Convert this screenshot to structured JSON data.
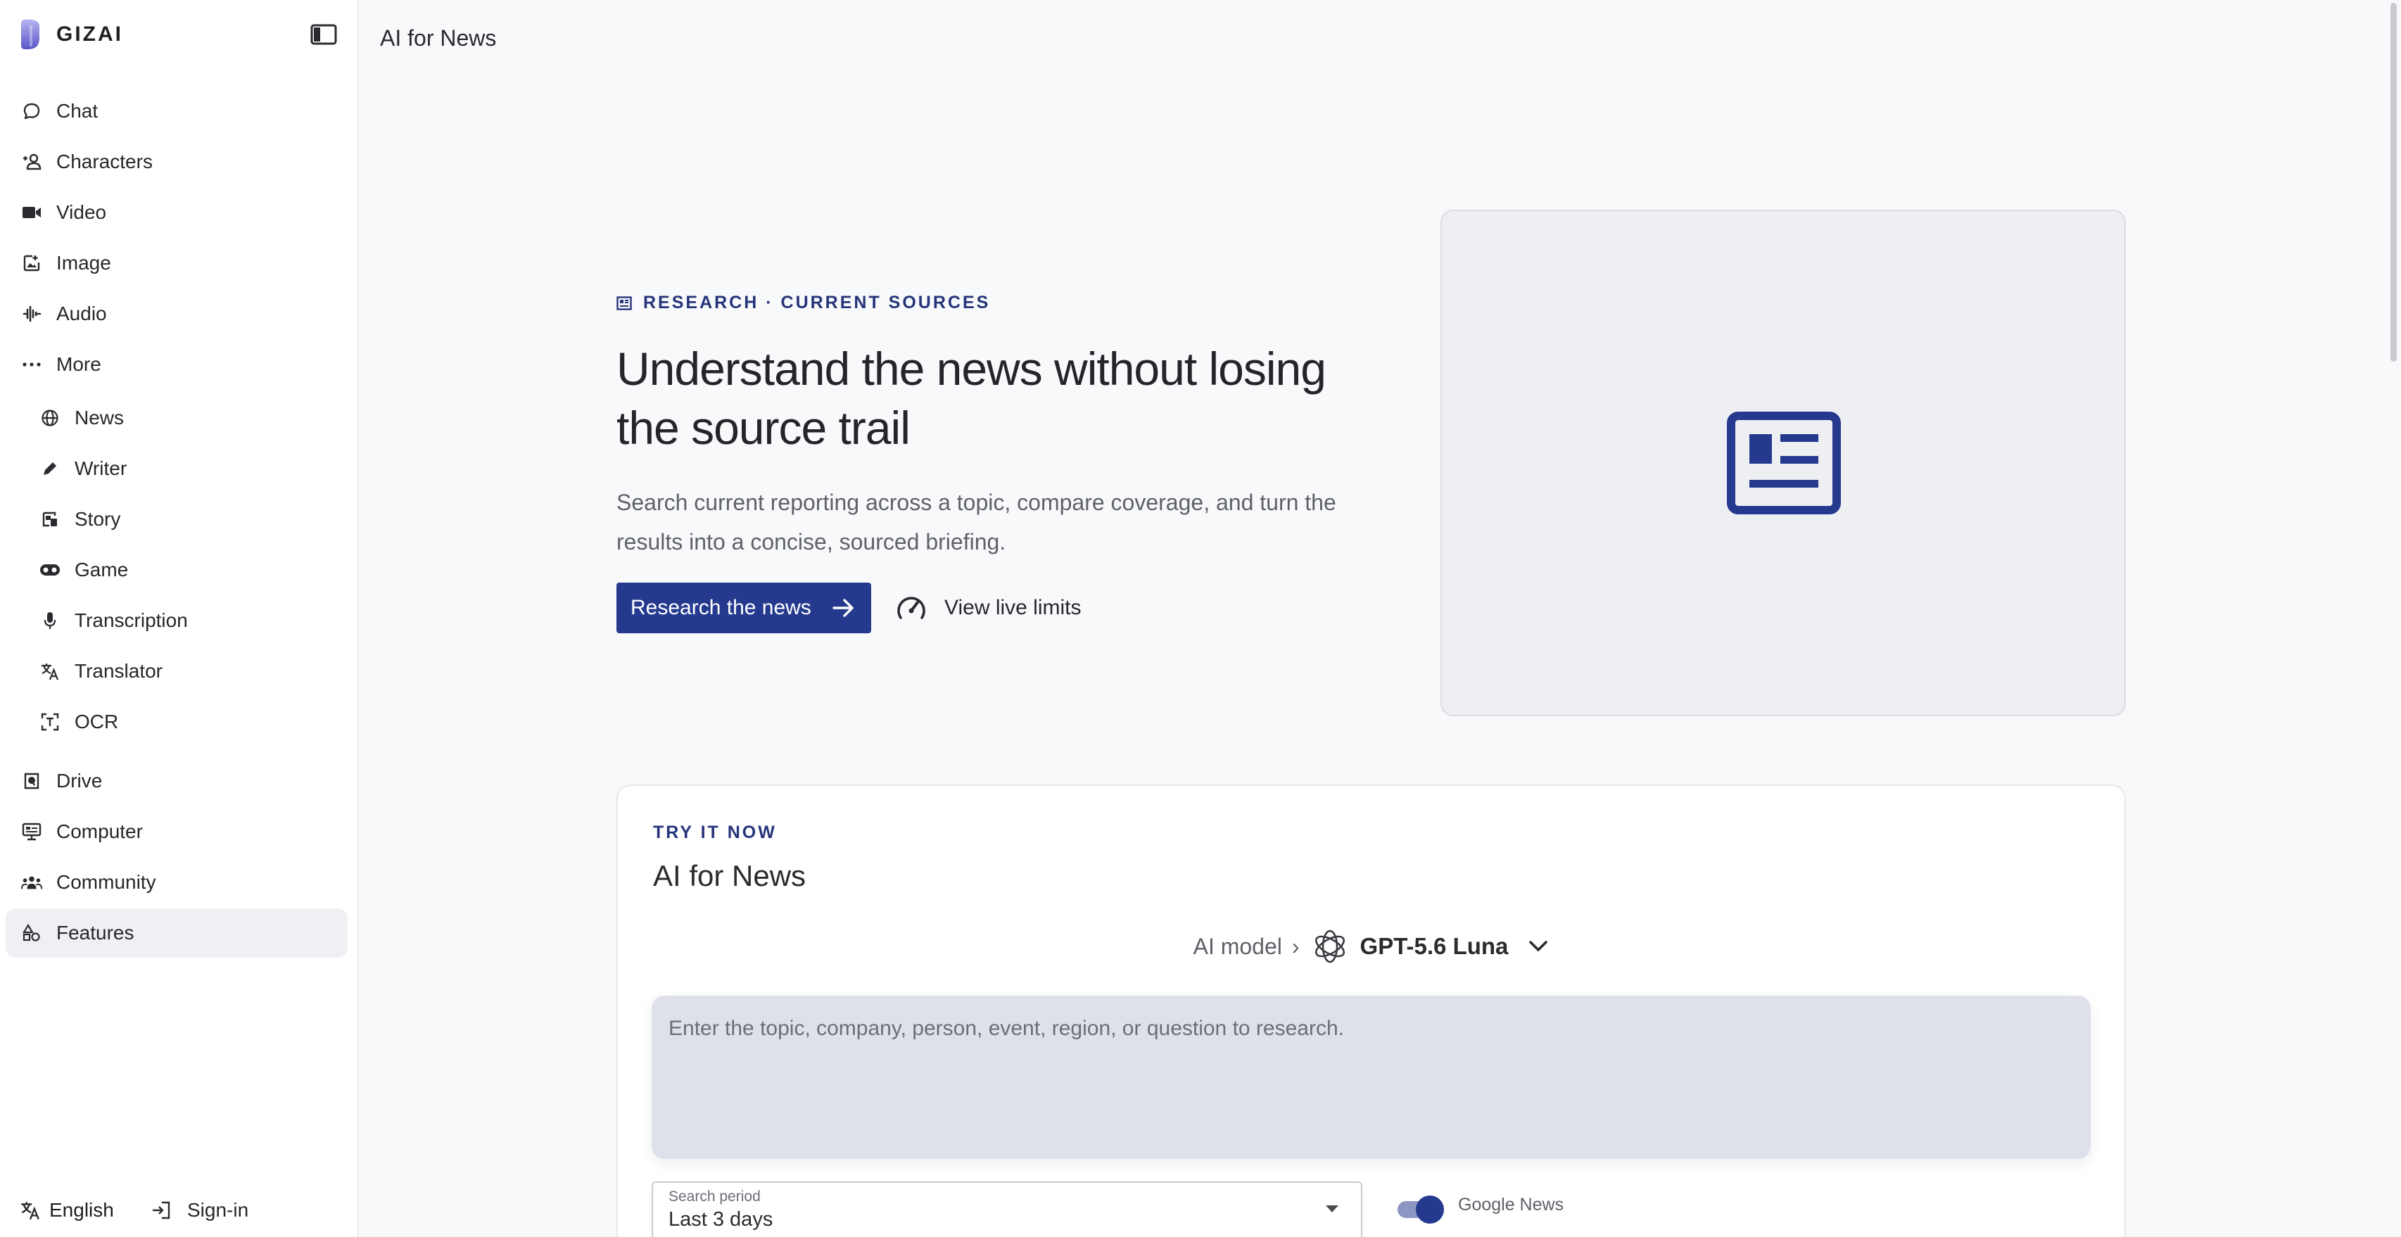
{
  "brand": {
    "name": "GIZAI"
  },
  "header": {
    "title": "AI for News"
  },
  "sidebar": {
    "items": [
      {
        "label": "Chat",
        "icon": "chat-bubble-icon"
      },
      {
        "label": "Characters",
        "icon": "person-add-icon"
      },
      {
        "label": "Video",
        "icon": "video-camera-icon"
      },
      {
        "label": "Image",
        "icon": "image-icon"
      },
      {
        "label": "Audio",
        "icon": "waveform-icon"
      },
      {
        "label": "More",
        "icon": "more-dots-icon"
      }
    ],
    "sub_items": [
      {
        "label": "News",
        "icon": "globe-icon"
      },
      {
        "label": "Writer",
        "icon": "pen-icon"
      },
      {
        "label": "Story",
        "icon": "story-book-icon"
      },
      {
        "label": "Game",
        "icon": "gamepad-icon"
      },
      {
        "label": "Transcription",
        "icon": "microphone-icon"
      },
      {
        "label": "Translator",
        "icon": "translate-icon"
      },
      {
        "label": "OCR",
        "icon": "text-scan-icon"
      }
    ],
    "bottom_items": [
      {
        "label": "Drive",
        "icon": "drive-icon"
      },
      {
        "label": "Computer",
        "icon": "monitor-icon"
      },
      {
        "label": "Community",
        "icon": "people-icon"
      },
      {
        "label": "Features",
        "icon": "shapes-icon",
        "active": true
      }
    ],
    "footer": {
      "language": "English",
      "signin": "Sign-in"
    }
  },
  "hero": {
    "eyebrow": "RESEARCH · CURRENT SOURCES",
    "headline_line1": "Understand the news without losing",
    "headline_line2": "the source trail",
    "subtitle": "Search current reporting across a topic, compare coverage, and turn the results into a concise, sourced briefing.",
    "primary_cta": "Research the news",
    "secondary_cta": "View live limits",
    "card_icon": "newspaper-icon"
  },
  "try_panel": {
    "eyebrow": "TRY IT NOW",
    "title": "AI for News",
    "model_prefix": "AI model",
    "model_sep": "›",
    "model_name": "GPT-5.6 Luna",
    "prompt_placeholder": "Enter the topic, company, person, event, region, or question to research.",
    "search_period_label": "Search period",
    "search_period_value": "Last 3 days",
    "toggle_label": "Google News",
    "toggle_on": true
  },
  "colors": {
    "accent": "#253a8f",
    "sidebar_active_bg": "#eef0f3",
    "prompt_bg": "#dfe1ea"
  }
}
